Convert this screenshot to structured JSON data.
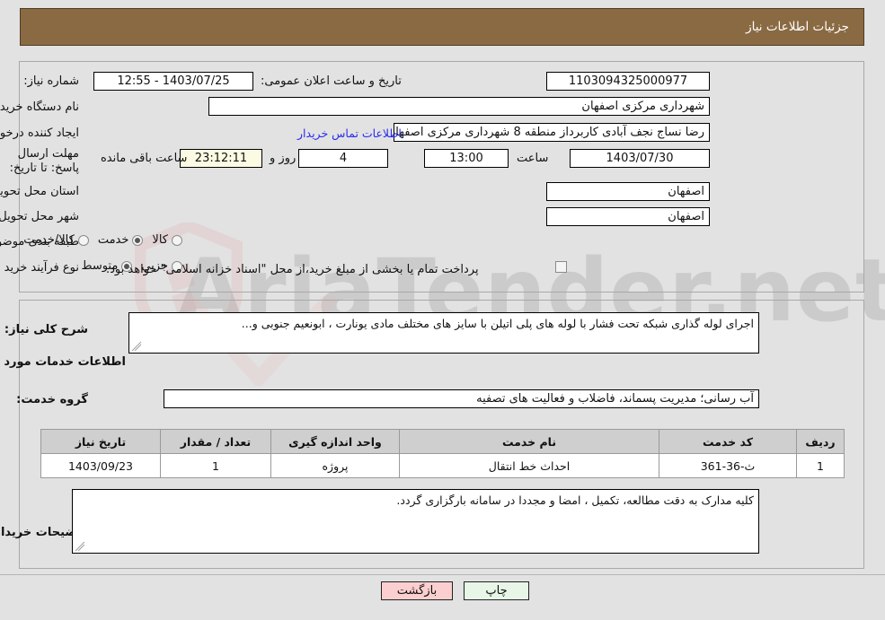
{
  "header": {
    "title": "جزئیات اطلاعات نیاز",
    "bg": "#8a6a42"
  },
  "watermark": {
    "text": "AriaTender.net"
  },
  "form": {
    "need_number_label": "شماره نیاز:",
    "need_number_value": "1103094325000977",
    "announce_datetime_label": "تاریخ و ساعت اعلان عمومی:",
    "announce_datetime_value": "12:55 - 1403/07/25",
    "buyer_org_label": "نام دستگاه خریدار:",
    "buyer_org_value": "شهرداری مرکزی اصفهان",
    "creator_label": "ایجاد کننده درخواست:",
    "creator_value": "رضا نساج نجف آبادی کاربرداز منطقه 8 شهرداری مرکزی اصفهان",
    "contact_link": "اطلاعات تماس خریدار",
    "deadline_label": "مهلت ارسال پاسخ: تا تاریخ:",
    "deadline_date": "1403/07/30",
    "hour_label": "ساعت",
    "deadline_time": "13:00",
    "days_value": "4",
    "days_label": "روز و",
    "countdown_value": "23:12:11",
    "remaining_label": "ساعت باقی مانده",
    "province_label": "استان محل تحویل:",
    "province_value": "اصفهان",
    "city_label": "شهر محل تحویل:",
    "city_value": "اصفهان",
    "category_label": "طبقه بندی موضوعی:",
    "category_options": [
      {
        "label": "کالا",
        "selected": false
      },
      {
        "label": "خدمت",
        "selected": true
      },
      {
        "label": "کالا/خدمت",
        "selected": false
      }
    ],
    "process_label": "نوع فرآیند خرید :",
    "process_options": [
      {
        "label": "جزیي",
        "selected": false
      },
      {
        "label": "متوسط",
        "selected": true
      }
    ],
    "treasury_checkbox_checked": false,
    "treasury_text": "پرداخت تمام یا بخشی از مبلغ خرید،از محل \"اسناد خزانه اسلامی\" خواهد بود."
  },
  "details": {
    "general_desc_label": "شرح کلی نیاز:",
    "general_desc_value": "اجرای لوله گذاری شبکه تحت فشار با لوله های پلی اتیلن با سایز های مختلف مادی یونارت ، ابونعیم جنوبی و...",
    "services_section_title": "اطلاعات خدمات مورد نیاز",
    "service_group_label": "گروه خدمت:",
    "service_group_value": "آب رسانی؛ مدیریت پسماند، فاضلاب و فعالیت های تصفیه",
    "buyer_notes_label": "توضیحات خریدار:",
    "buyer_notes_value": "کلیه مدارک به دقت مطالعه، تکمیل ، امضا و مجددا در سامانه بارگزاری گردد."
  },
  "table": {
    "columns": [
      "ردیف",
      "کد خدمت",
      "نام خدمت",
      "واحد اندازه گیری",
      "تعداد / مقدار",
      "تاریخ نیاز"
    ],
    "rows": [
      {
        "row": "1",
        "code": "ث-36-361",
        "name": "احداث خط انتقال",
        "unit": "پروژه",
        "qty": "1",
        "date": "1403/09/23"
      }
    ]
  },
  "buttons": {
    "print": "چاپ",
    "back": "بازگشت"
  }
}
